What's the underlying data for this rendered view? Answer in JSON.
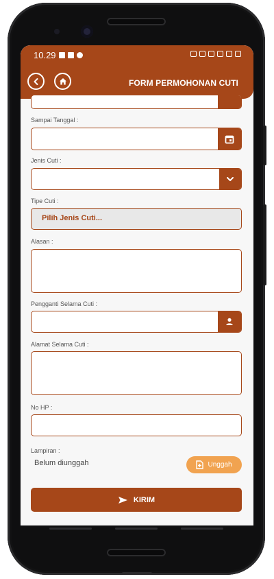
{
  "status_bar": {
    "time": "10.29"
  },
  "header": {
    "title": "FORM PERMOHONAN CUTI"
  },
  "form": {
    "sampai_label": "Sampai Tanggal :",
    "jenis_label": "Jenis Cuti :",
    "tipe_label": "Tipe Cuti :",
    "tipe_value": "Pilih Jenis Cuti...",
    "alasan_label": "Alasan :",
    "pengganti_label": "Pengganti Selama Cuti :",
    "alamat_label": "Alamat Selama Cuti :",
    "hp_label": "No HP :",
    "lampiran_label": "Lampiran :",
    "lampiran_status": "Belum diunggah",
    "upload_label": "Unggah",
    "submit_label": "KIRIM"
  },
  "colors": {
    "primary": "#a64719",
    "upload": "#f1a350"
  },
  "icons": [
    "back-icon",
    "home-icon",
    "calendar-icon",
    "chevron-down-icon",
    "person-icon",
    "upload-file-icon",
    "send-icon"
  ]
}
